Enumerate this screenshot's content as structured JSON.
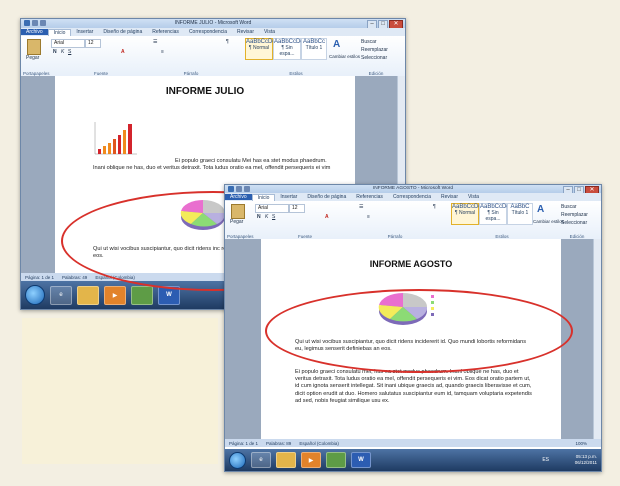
{
  "window_back": {
    "title": "INFORME JULIO - Microsoft Word",
    "tabs": [
      "Archivo",
      "Inicio",
      "Insertar",
      "Diseño de página",
      "Referencias",
      "Correspondencia",
      "Revisar",
      "Vista"
    ],
    "active_tab": "Inicio",
    "font_name": "Arial",
    "font_size": "12",
    "paste_label": "Pegar",
    "groups": [
      "Portapapeles",
      "Fuente",
      "Párrafo",
      "Estilos",
      "Edición"
    ],
    "styles": [
      {
        "sample": "AaBbCcDc",
        "name": "¶ Normal"
      },
      {
        "sample": "AaBbCcDc",
        "name": "¶ Sin espa..."
      },
      {
        "sample": "AaBbCc",
        "name": "Título 1"
      }
    ],
    "change_styles": "Cambiar estilos",
    "edit_items": [
      "Buscar",
      "Reemplazar",
      "Seleccionar"
    ],
    "document": {
      "heading": "INFORME JULIO",
      "para1": "Ei populo graeci consulatu Mei has ea stet modus phaedrum. Inani oblique ne has, duo et veritus detraxit. Tota ludus oratio ea mel, offendit persequeris ei vim",
      "para2": "Qui ut wisi vocibus suscipiantur, quo dicit ridens inc reformidans eu, legimus senserit definiebas an eos."
    },
    "status": [
      "Página: 1 de 1",
      "Palabras: 49",
      "Español (Colombia)"
    ],
    "taskbar_word_label": "W"
  },
  "window_front": {
    "title": "INFORME AGOSTO - Microsoft Word",
    "tabs": [
      "Archivo",
      "Inicio",
      "Insertar",
      "Diseño de página",
      "Referencias",
      "Correspondencia",
      "Revisar",
      "Vista"
    ],
    "active_tab": "Inicio",
    "font_name": "Arial",
    "font_size": "12",
    "paste_label": "Pegar",
    "groups": [
      "Portapapeles",
      "Fuente",
      "Párrafo",
      "Estilos",
      "Edición"
    ],
    "styles": [
      {
        "sample": "AaBbCcDc",
        "name": "¶ Normal"
      },
      {
        "sample": "AaBbCcDc",
        "name": "¶ Sin espa..."
      },
      {
        "sample": "AaBbC",
        "name": "Título 1"
      }
    ],
    "change_styles": "Cambiar estilos",
    "edit_items": [
      "Buscar",
      "Reemplazar",
      "Seleccionar"
    ],
    "document": {
      "heading": "INFORME AGOSTO",
      "para1": "Qui ut wisi vocibus suscipiantur, quo dicit ridens incidererit id. Quo mundi lobortis reformidans eu, legimus senserit definiebas an eos.",
      "para2": "Ei populo graeci consulatu mei, has ea stet modus phaedrum. Inani oblique ne has, duo et veritus detraxit. Tota ludus oratio ea mel, offendit persequeris ei vim. Eos dicat oratio partem ut, id cum ignota senserit intellegat. Sit inani ubique graecis ad, quando graecis liberavisse et cum, dicit option erudit at duo. Homero salutatus suscipiantur eum id, tamquam voluptaria expetendis ad sed, nobis feugiat similique usu ex."
    },
    "status": [
      "Página: 1 de 1",
      "Palabras: 89",
      "Español (Colombia)"
    ],
    "zoom": "100%",
    "clock_time": "05:13 p.m.",
    "clock_date": "06/12/2011",
    "tray_lang": "ES",
    "taskbar_word_label": "W"
  },
  "colors": {
    "annotation_ellipse": "#d8312b",
    "word_blue": "#2b5fb0",
    "taskbar": "#1f3b62"
  }
}
